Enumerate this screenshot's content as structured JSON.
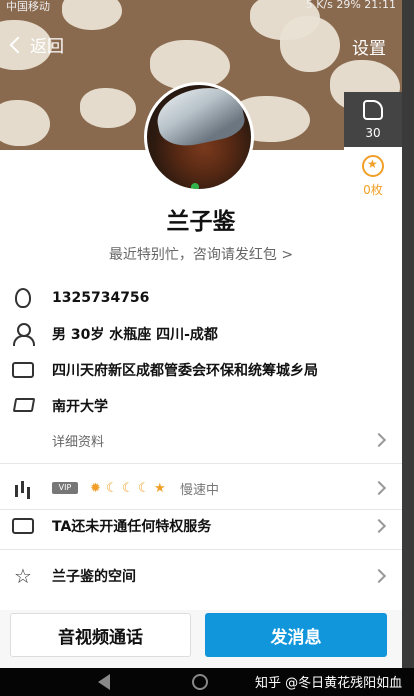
{
  "status_bar": {
    "carrier": "中国移动",
    "right": "5 K/s 29% 21:11"
  },
  "header": {
    "back_label": "返回",
    "settings_label": "设置"
  },
  "like": {
    "count": "30"
  },
  "coin": {
    "count": "0枚"
  },
  "profile": {
    "name": "兰子鉴",
    "signature": "最近特别忙，咨询请发红包 >",
    "qq": "1325734756",
    "info": "男  30岁  水瓶座  四川-成都",
    "company": "四川天府新区成都管委会环保和统筹城乡局",
    "school": "南开大学",
    "detail_link": "详细资料"
  },
  "rows": {
    "vip_label": "VIP",
    "speed": "慢速中",
    "privilege": "TA还未开通任何特权服务",
    "space": "兰子鉴的空间"
  },
  "buttons": {
    "call": "音视频通话",
    "message": "发消息"
  },
  "watermark": "知乎 @冬日黄花残阳如血",
  "colors": {
    "primary": "#1296db",
    "banner": "#8a6a4f",
    "accent": "#f0a028"
  }
}
